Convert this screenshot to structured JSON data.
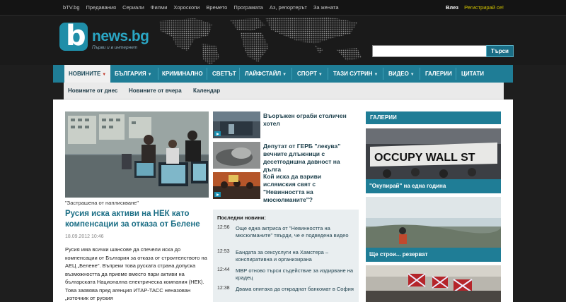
{
  "topbar": {
    "links": [
      "bTV.bg",
      "Предавания",
      "Сериали",
      "Филми",
      "Хороскопи",
      "Времето",
      "Програмата",
      "Аз, репортерът",
      "За жената"
    ],
    "login": "Влез",
    "register": "Регистрирай се!"
  },
  "header": {
    "logo_letter": "b",
    "site_name": "news.bg",
    "tagline": "Първи и в интернет",
    "search_placeholder": "",
    "search_button": "Търси"
  },
  "nav": {
    "items": [
      "НОВИНИТЕ",
      "БЪЛГАРИЯ",
      "КРИМИНАЛНО",
      "СВЕТЪТ",
      "ЛАЙФСТАЙЛ",
      "СПОРТ",
      "ТАЗИ СУТРИН",
      "ВИДЕО",
      "ГАЛЕРИИ",
      "ЦИТАТИ"
    ]
  },
  "subnav": {
    "items": [
      "Новините от днес",
      "Новините от вчера",
      "Календар"
    ]
  },
  "lead": {
    "caption": "\"Застрашена от наплискване\"",
    "headline": "Русия иска активи на НЕК като компенсации за отказа от Белене",
    "date": "18.09.2012 10:46",
    "body": "Русия има всички шансове да спечели иска до компенсации от България за отказа от строителството на АЕЦ „Белене\". Въпреки това руската страна допуска възможността да приеме вместо пари активи на българската Национална електрическа компания (НЕК). Това заявява пред агенция ИТАР-ТАСС неназован „източник от руския"
  },
  "stories": [
    {
      "title": "Въоръжен ограби столичен хотел"
    },
    {
      "title": "Депутат от ГЕРБ \"лекува\" вечните длъжници с десетгодишна давност на дълга"
    },
    {
      "title": "Кой иска да взриви ислямския свят с \"Невинността на мюсюлманите\"?"
    }
  ],
  "latest": {
    "heading": "Последни новини:",
    "items": [
      {
        "time": "12:56",
        "text": "Още една актриса от \"Невинността на мюсюлманите\" твърди, че е подведена видео"
      },
      {
        "time": "12:53",
        "text": "Бандата за сексуслуги на Хамстера – конспиративна и организирана"
      },
      {
        "time": "12:44",
        "text": "МВР отново търси съдействие за издирване на крадец"
      },
      {
        "time": "12:38",
        "text": "Двама опитаха да откраднат банкомат в София"
      }
    ]
  },
  "galleries": {
    "heading": "ГАЛЕРИИ",
    "items": [
      {
        "caption": "\"Окупирай\" на една година",
        "banner": "OCCUPY WALL ST"
      },
      {
        "caption": "Ще строи... резерват"
      },
      {
        "caption": ""
      }
    ]
  },
  "colors": {
    "accent": "#1f7d96",
    "background": "#1e1e1e",
    "register": "#d2c400",
    "headline": "#1b6e85"
  }
}
